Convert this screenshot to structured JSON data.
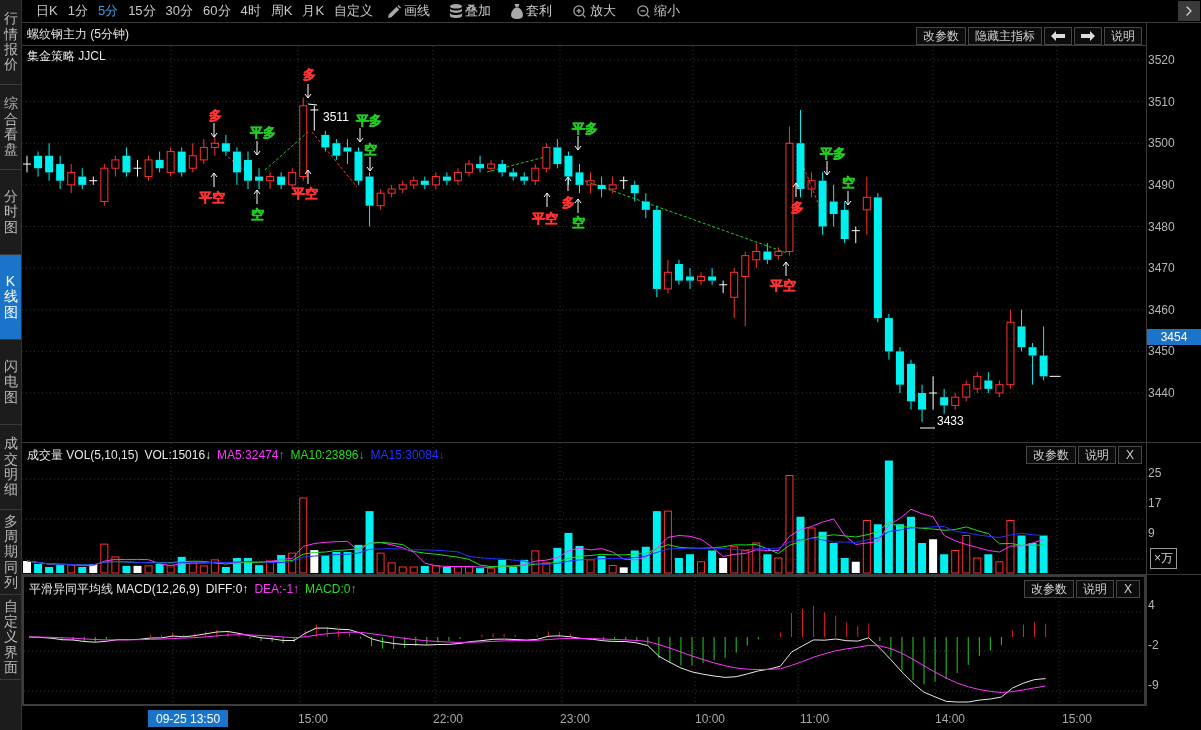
{
  "sidebar": {
    "items": [
      {
        "label": "行情报价",
        "selected": false
      },
      {
        "label": "综合看盘",
        "selected": false
      },
      {
        "label": "分时图",
        "selected": false
      },
      {
        "label": "K线图",
        "selected": true
      },
      {
        "label": "闪电图",
        "selected": false
      },
      {
        "label": "成交明细",
        "selected": false
      },
      {
        "label": "多周期同列",
        "selected": false
      },
      {
        "label": "自定义界面",
        "selected": false
      }
    ]
  },
  "toolbar": {
    "periods": [
      {
        "label": "日K",
        "selected": false
      },
      {
        "label": "1分",
        "selected": false
      },
      {
        "label": "5分",
        "selected": true
      },
      {
        "label": "15分",
        "selected": false
      },
      {
        "label": "30分",
        "selected": false
      },
      {
        "label": "60分",
        "selected": false
      },
      {
        "label": "4时",
        "selected": false
      },
      {
        "label": "周K",
        "selected": false
      },
      {
        "label": "月K",
        "selected": false
      },
      {
        "label": "自定义",
        "selected": false
      }
    ],
    "tools": [
      {
        "kind": "pencil",
        "label": "画线"
      },
      {
        "kind": "stack",
        "label": "叠加"
      },
      {
        "kind": "bag",
        "label": "套利"
      },
      {
        "kind": "zoom-in",
        "label": "放大"
      },
      {
        "kind": "zoom-out",
        "label": "缩小"
      }
    ]
  },
  "price_chart": {
    "title": "螺纹钢主力 (5分钟)",
    "indicator": "集金策略 JJCL",
    "buttons": [
      {
        "kind": "text",
        "label": "改参数"
      },
      {
        "kind": "text",
        "label": "隐藏主指标"
      },
      {
        "kind": "arrow-left"
      },
      {
        "kind": "arrow-right"
      },
      {
        "kind": "text",
        "label": "说明"
      }
    ],
    "price_axis": [
      "3520",
      "3510",
      "3500",
      "3490",
      "3480",
      "3470",
      "3460",
      "3450",
      "3440"
    ],
    "current_price": "3454",
    "signals": [
      {
        "label": "多",
        "color": "#ff3333",
        "kind": "above"
      },
      {
        "label": "平空",
        "color": "#ff3333",
        "kind": "below"
      },
      {
        "label": "平多",
        "color": "#22cc22",
        "kind": "above"
      },
      {
        "label": "空",
        "color": "#22cc22",
        "kind": "below"
      },
      {
        "label": "多",
        "color": "#ff3333",
        "kind": "above"
      },
      {
        "label": "平空",
        "color": "#ff3333",
        "kind": "below"
      },
      {
        "label": "平多",
        "color": "#22cc22",
        "kind": "above"
      },
      {
        "label": "空",
        "color": "#22cc22",
        "kind": "above"
      },
      {
        "label": "平空",
        "color": "#ff3333",
        "kind": "below"
      },
      {
        "label": "平多",
        "color": "#22cc22",
        "kind": "above"
      },
      {
        "label": "多",
        "color": "#ff3333",
        "kind": "below"
      },
      {
        "label": "空",
        "color": "#22cc22",
        "kind": "below"
      },
      {
        "label": "平空",
        "color": "#ff3333",
        "kind": "below"
      },
      {
        "label": "多",
        "color": "#ff3333",
        "kind": "below"
      },
      {
        "label": "平多",
        "color": "#22cc22",
        "kind": "above"
      },
      {
        "label": "空",
        "color": "#22cc22",
        "kind": "above"
      }
    ],
    "extremes": [
      "3511",
      "3433"
    ]
  },
  "volume_panel": {
    "title": "成交量 VOL(5,10,15)",
    "readings": [
      {
        "label": "VOL:15016↓",
        "color": "#e8e8e8"
      },
      {
        "label": "MA5:32474↑",
        "color": "#ff33ff"
      },
      {
        "label": "MA10:23896↓",
        "color": "#22dd22"
      },
      {
        "label": "MA15:30084↓",
        "color": "#2233ff"
      }
    ],
    "buttons": [
      {
        "kind": "text",
        "label": "改参数"
      },
      {
        "kind": "text",
        "label": "说明"
      },
      {
        "kind": "text",
        "label": "X"
      }
    ],
    "axis": [
      "25",
      "17",
      "9"
    ],
    "unit": "×万"
  },
  "macd_panel": {
    "title": "平滑异同平均线 MACD(12,26,9)",
    "readings": [
      {
        "label": "DIFF:0↑",
        "color": "#e8e8e8"
      },
      {
        "label": "DEA:-1↑",
        "color": "#ff33ff"
      },
      {
        "label": "MACD:0↑",
        "color": "#22dd22"
      }
    ],
    "buttons": [
      {
        "kind": "text",
        "label": "改参数"
      },
      {
        "kind": "text",
        "label": "说明"
      },
      {
        "kind": "text",
        "label": "X"
      }
    ],
    "axis": [
      "4",
      "-2",
      "-9"
    ]
  },
  "time_axis": {
    "cursor": "09-25 13:50",
    "labels": [
      "15:00",
      "22:00",
      "23:00",
      "10:00",
      "11:00",
      "14:00",
      "15:00"
    ]
  }
}
